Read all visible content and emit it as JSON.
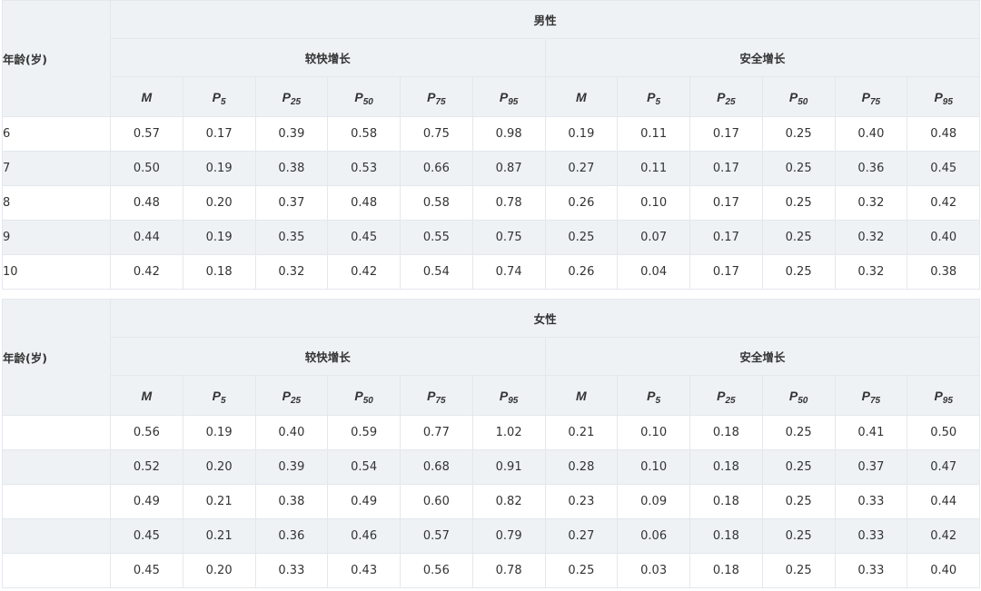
{
  "colors": {
    "header_bg": "#eef2f5",
    "stripe_bg": "#eef2f5",
    "border": "#e4e8ec",
    "text": "#333333"
  },
  "columns": [
    {
      "base": "M",
      "sub": ""
    },
    {
      "base": "P",
      "sub": "5"
    },
    {
      "base": "P",
      "sub": "25"
    },
    {
      "base": "P",
      "sub": "50"
    },
    {
      "base": "P",
      "sub": "75"
    },
    {
      "base": "P",
      "sub": "95"
    }
  ],
  "tables": [
    {
      "age_header": "年龄(岁)",
      "sex": "男性",
      "groups": [
        "较快增长",
        "安全增长"
      ],
      "rows": [
        {
          "age": "6",
          "values": [
            "0.57",
            "0.17",
            "0.39",
            "0.58",
            "0.75",
            "0.98",
            "0.19",
            "0.11",
            "0.17",
            "0.25",
            "0.40",
            "0.48"
          ]
        },
        {
          "age": "7",
          "values": [
            "0.50",
            "0.19",
            "0.38",
            "0.53",
            "0.66",
            "0.87",
            "0.27",
            "0.11",
            "0.17",
            "0.25",
            "0.36",
            "0.45"
          ]
        },
        {
          "age": "8",
          "values": [
            "0.48",
            "0.20",
            "0.37",
            "0.48",
            "0.58",
            "0.78",
            "0.26",
            "0.10",
            "0.17",
            "0.25",
            "0.32",
            "0.42"
          ]
        },
        {
          "age": "9",
          "values": [
            "0.44",
            "0.19",
            "0.35",
            "0.45",
            "0.55",
            "0.75",
            "0.25",
            "0.07",
            "0.17",
            "0.25",
            "0.32",
            "0.40"
          ]
        },
        {
          "age": "10",
          "values": [
            "0.42",
            "0.18",
            "0.32",
            "0.42",
            "0.54",
            "0.74",
            "0.26",
            "0.04",
            "0.17",
            "0.25",
            "0.32",
            "0.38"
          ]
        }
      ]
    },
    {
      "age_header": "年龄(岁)",
      "sex": "女性",
      "groups": [
        "较快增长",
        "安全增长"
      ],
      "rows": [
        {
          "age": "",
          "values": [
            "0.56",
            "0.19",
            "0.40",
            "0.59",
            "0.77",
            "1.02",
            "0.21",
            "0.10",
            "0.18",
            "0.25",
            "0.41",
            "0.50"
          ]
        },
        {
          "age": "",
          "values": [
            "0.52",
            "0.20",
            "0.39",
            "0.54",
            "0.68",
            "0.91",
            "0.28",
            "0.10",
            "0.18",
            "0.25",
            "0.37",
            "0.47"
          ]
        },
        {
          "age": "",
          "values": [
            "0.49",
            "0.21",
            "0.38",
            "0.49",
            "0.60",
            "0.82",
            "0.23",
            "0.09",
            "0.18",
            "0.25",
            "0.33",
            "0.44"
          ]
        },
        {
          "age": "",
          "values": [
            "0.45",
            "0.21",
            "0.36",
            "0.46",
            "0.57",
            "0.79",
            "0.27",
            "0.06",
            "0.18",
            "0.25",
            "0.33",
            "0.42"
          ]
        },
        {
          "age": "",
          "values": [
            "0.45",
            "0.20",
            "0.33",
            "0.43",
            "0.56",
            "0.78",
            "0.25",
            "0.03",
            "0.18",
            "0.25",
            "0.33",
            "0.40"
          ]
        }
      ]
    }
  ]
}
